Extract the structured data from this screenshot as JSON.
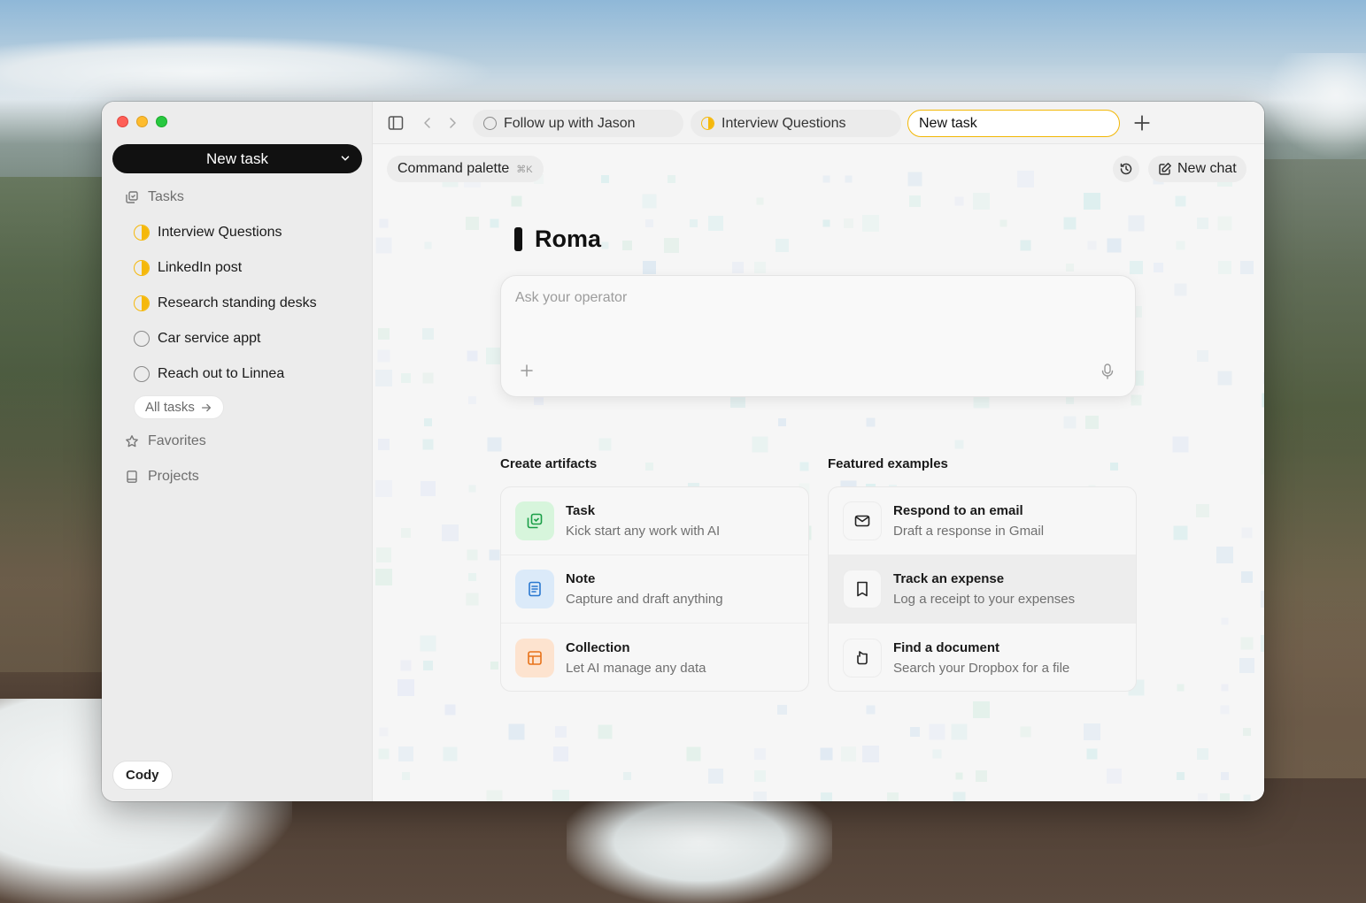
{
  "sidebar": {
    "new_task_label": "New task",
    "tasks_label": "Tasks",
    "tasks": [
      {
        "label": "Interview Questions",
        "status": "in-progress"
      },
      {
        "label": "LinkedIn post",
        "status": "in-progress"
      },
      {
        "label": "Research standing desks",
        "status": "in-progress"
      },
      {
        "label": "Car service appt",
        "status": "todo"
      },
      {
        "label": "Reach out to Linnea",
        "status": "todo"
      }
    ],
    "all_tasks_label": "All tasks",
    "favorites_label": "Favorites",
    "projects_label": "Projects",
    "user_name": "Cody"
  },
  "tabs": [
    {
      "label": "Follow up with Jason",
      "status": "todo"
    },
    {
      "label": "Interview Questions",
      "status": "in-progress"
    },
    {
      "label": "New task",
      "status": "active"
    }
  ],
  "toolbar": {
    "command_palette_label": "Command palette",
    "command_palette_shortcut": "⌘K",
    "new_chat_label": "New chat"
  },
  "main": {
    "agent_name": "Roma",
    "prompt_placeholder": "Ask your operator",
    "create_artifacts_title": "Create artifacts",
    "featured_examples_title": "Featured examples",
    "artifacts": [
      {
        "title": "Task",
        "subtitle": "Kick start any work with AI",
        "icon": "task-icon"
      },
      {
        "title": "Note",
        "subtitle": "Capture and draft anything",
        "icon": "note-icon"
      },
      {
        "title": "Collection",
        "subtitle": "Let AI manage any data",
        "icon": "collection-icon"
      }
    ],
    "examples": [
      {
        "title": "Respond to an email",
        "subtitle": "Draft a response in Gmail",
        "icon": "mail-icon"
      },
      {
        "title": "Track an expense",
        "subtitle": "Log a receipt to your expenses",
        "icon": "receipt-icon"
      },
      {
        "title": "Find a document",
        "subtitle": "Search your Dropbox for a file",
        "icon": "dropbox-icon"
      }
    ]
  },
  "colors": {
    "accent_yellow": "#f5b80b",
    "sidebar_bg": "#ececec",
    "primary_button": "#111111"
  }
}
